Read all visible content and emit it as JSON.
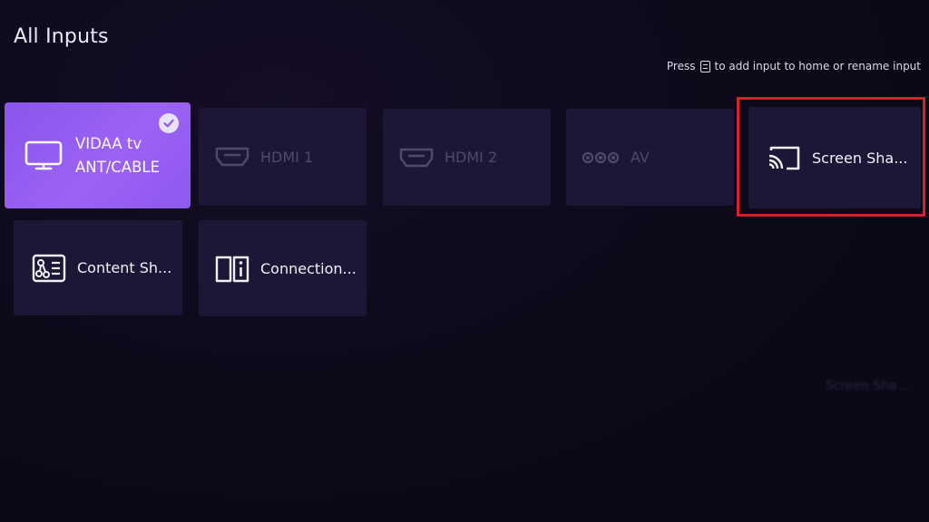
{
  "page": {
    "title": "All Inputs"
  },
  "hint": {
    "press": "Press",
    "action": "to add input to home or rename input",
    "key_icon": "menu-key-icon"
  },
  "inputs": [
    {
      "line1": "VIDAA tv",
      "line2": "ANT/CABLE",
      "icon": "tv-icon",
      "selected": true,
      "checked": true
    },
    {
      "label": "HDMI 1",
      "icon": "hdmi-icon",
      "disabled": true
    },
    {
      "label": "HDMI 2",
      "icon": "hdmi-icon",
      "disabled": true
    },
    {
      "label": "AV",
      "icon": "av-icon",
      "disabled": true
    },
    {
      "label": "Screen Sha...",
      "icon": "screen-share-icon",
      "highlighted": true
    }
  ],
  "apps": [
    {
      "label": "Content Sh...",
      "icon": "content-share-icon"
    },
    {
      "label": "Connection...",
      "icon": "connection-guide-icon"
    }
  ],
  "ghost": {
    "label": "Screen Sha..."
  },
  "colors": {
    "background": "#0d0918",
    "tile": "#1d1737",
    "selected_tile": "#8a55ec",
    "highlight_border": "#d6232a",
    "disabled_text": "#4f4a6a"
  }
}
